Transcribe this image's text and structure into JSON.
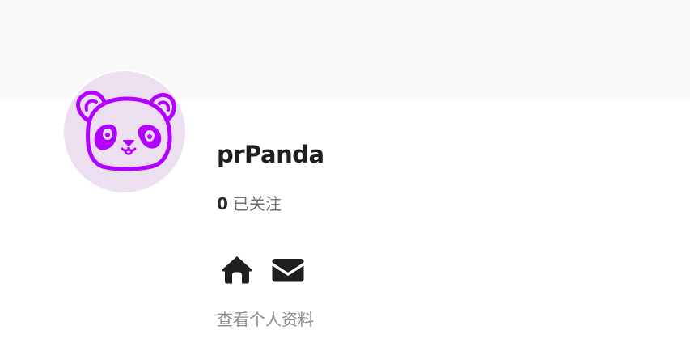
{
  "profile": {
    "username": "prPanda",
    "following_count": "0",
    "following_label": "已关注",
    "view_profile_label": "查看个人资料",
    "avatar_icon": "panda-face-icon"
  },
  "actions": {
    "home_icon": "home-icon",
    "mail_icon": "envelope-icon"
  },
  "colors": {
    "cover_bg": "#f9f9f9",
    "avatar_bg": "#ebdff0",
    "avatar_stroke": "#b300ff",
    "text_primary": "#1f1f1f",
    "text_muted": "#8a8a8a"
  }
}
